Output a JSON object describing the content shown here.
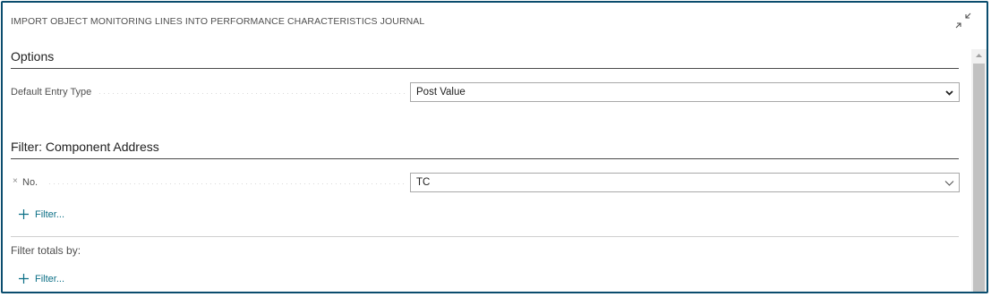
{
  "dialog": {
    "title": "IMPORT OBJECT MONITORING LINES INTO PERFORMANCE CHARACTERISTICS JOURNAL",
    "collapse_icon": "collapse-icon"
  },
  "options": {
    "header": "Options",
    "default_entry_type": {
      "label": "Default Entry Type",
      "value": "Post Value",
      "icon": "chevron-down-icon"
    }
  },
  "filter_component": {
    "header": "Filter: Component Address",
    "no_field": {
      "remove_symbol": "×",
      "label": "No.",
      "value": "TC",
      "icon": "chevron-down-icon"
    },
    "add_filter_label": "Filter..."
  },
  "filter_totals": {
    "label": "Filter totals by:",
    "add_filter_label": "Filter..."
  },
  "colors": {
    "border": "#0b4d6e",
    "link": "#0b6f86"
  }
}
